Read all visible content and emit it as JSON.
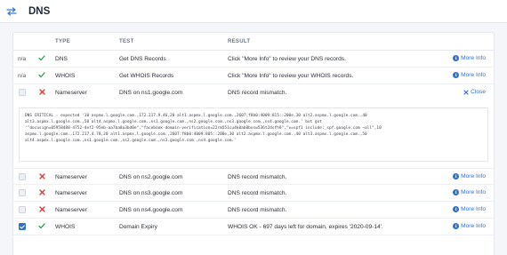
{
  "header": {
    "title": "DNS",
    "icon": "swap-arrows-icon"
  },
  "table": {
    "columns": [
      "TYPE",
      "TEST",
      "RESULT"
    ],
    "rows": [
      {
        "status": "n/a",
        "state": "pass",
        "type": "DNS",
        "test": "Get DNS Records",
        "result": "Click \"More Info\" to review your DNS records.",
        "action": "More Info"
      },
      {
        "status": "n/a",
        "state": "pass",
        "type": "WHOIS",
        "test": "Get WHOIS Records",
        "result": "Click \"More Info\" to review your WHOIS records.",
        "action": "More Info"
      },
      {
        "status": "",
        "state": "fail",
        "type": "Nameserver",
        "test": "DNS on ns1.google.com",
        "result": "DNS record mismatch.",
        "action": "Close"
      },
      {
        "status": "",
        "state": "fail",
        "type": "Nameserver",
        "test": "DNS on ns2.google.com",
        "result": "DNS record mismatch.",
        "action": "More Info"
      },
      {
        "status": "",
        "state": "fail",
        "type": "Nameserver",
        "test": "DNS on ns3.google.com",
        "result": "DNS record mismatch.",
        "action": "More Info"
      },
      {
        "status": "",
        "state": "fail",
        "type": "Nameserver",
        "test": "DNS on ns4.google.com",
        "result": "DNS record mismatch.",
        "action": "More Info"
      },
      {
        "status": "",
        "state": "pass",
        "checked": true,
        "type": "WHOIS",
        "test": "Domain Expiry",
        "result": "WHOIS OK - 697 days left for domain, expires '2020-09-14'.",
        "action": "More Info"
      }
    ]
  },
  "detail": {
    "lines": [
      "DNS CRITICAL - expected '10 aspmx.l.google.com.,172.217.9.46,20 alt1.aspmx.l.google.com.,2607:f8b0:4009:815::200e,30 alt2.aspmx.l.google.com.,40",
      "alt3.aspmx.l.google.com.,50 alt4.aspmx.l.google.com.,ns1.google.com.,ns2.google.com.,ns3.google.com.,ns4.google.com.' but got",
      "'\"docusign=05958488-4752-4ef2-95eb-aa7ba8a3bd0e\",\"facebook-domain-verification=22rm551cu4k0ab0bxsw536t2dsfh9\",\"v=spf1 include:_spf.google.com ~all\",10",
      "aspmx.l.google.com.,172.217.4.78,20 alt1.aspmx.l.google.com.,2607:f8b0:4009:805::200e,30 alt2.aspmx.l.google.com.,40 alt3.aspmx.l.google.com.,50",
      "alt4.aspmx.l.google.com.,ns1.google.com.,ns2.google.com.,ns3.google.com.,ns4.google.com.'"
    ]
  },
  "colors": {
    "accent": "#2f6fcf",
    "pass": "#2e9e4f",
    "fail": "#d93636"
  }
}
